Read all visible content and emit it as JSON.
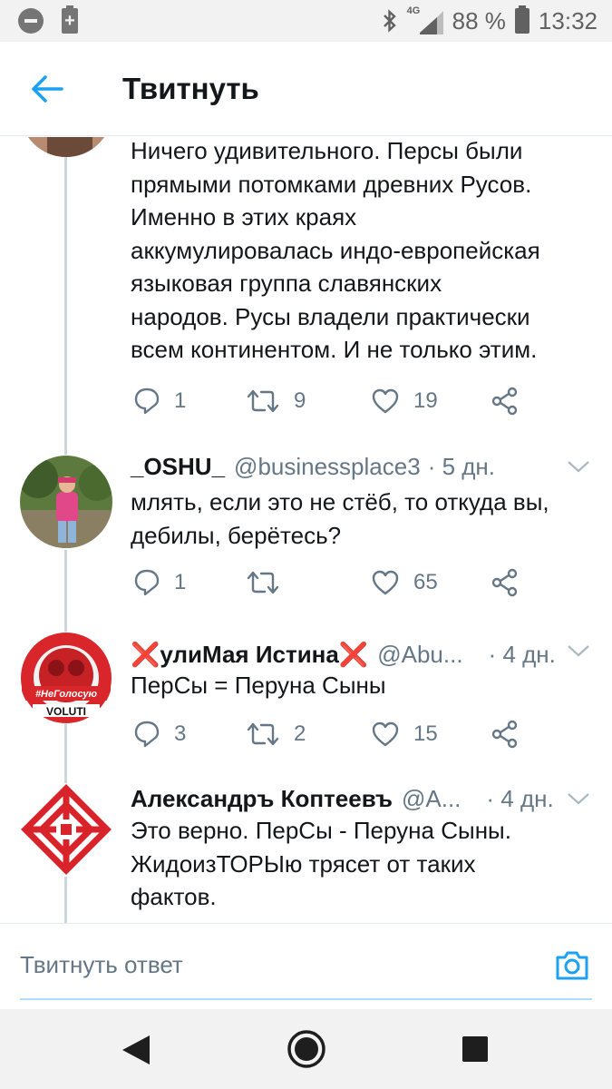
{
  "status_bar": {
    "network": "4G",
    "battery": "88 %",
    "time": "13:32"
  },
  "header": {
    "title": "Твитнуть"
  },
  "tweets": [
    {
      "text": [
        "Ничего удивительного. Персы были",
        "прямыми потомками древних Русов.",
        "Именно в этих краях",
        "аккумулировалась индо-европейская",
        "языковая группа славянских",
        "народов. Русы владели практически",
        "всем континентом. И не только этим."
      ],
      "replies": "1",
      "retweets": "9",
      "likes": "19"
    },
    {
      "name": "_OSHU_",
      "handle": "@businessplace3",
      "time": "· 5 дн.",
      "text": [
        "млять, если это не стёб, то откуда вы,",
        "дебилы, берётесь?"
      ],
      "replies": "1",
      "retweets": "",
      "likes": "65"
    },
    {
      "name": "❌улиМая Истина❌",
      "handle": "@Abu...",
      "time": "· 4 дн.",
      "text": [
        "ПерСы = Перуна Сыны"
      ],
      "replies": "3",
      "retweets": "2",
      "likes": "15",
      "avatar_text": {
        "banner": "#НеГолосую",
        "bottom": "VOLUTI"
      }
    },
    {
      "name": "Александръ Коптеевъ",
      "handle": "@А...",
      "time": "· 4 дн.",
      "text": [
        "Это верно. ПерСы - Перуна Сыны.",
        "ЖидоизТОРЫю трясет от таких",
        "фактов."
      ]
    }
  ],
  "reply_bar": {
    "placeholder": "Твитнуть ответ"
  },
  "colors": {
    "accent": "#1da1f2",
    "secondary_text": "#657786",
    "thread_line": "#ccd6dd",
    "emoji_red": "#e0282e"
  },
  "icons": [
    "minus-circle-icon",
    "battery-plus-icon",
    "bluetooth-icon",
    "signal-icon",
    "battery-icon",
    "back-arrow-icon",
    "reply-icon",
    "retweet-icon",
    "heart-icon",
    "share-icon",
    "chevron-down-icon",
    "camera-icon",
    "nav-back-icon",
    "nav-home-icon",
    "nav-recents-icon"
  ]
}
